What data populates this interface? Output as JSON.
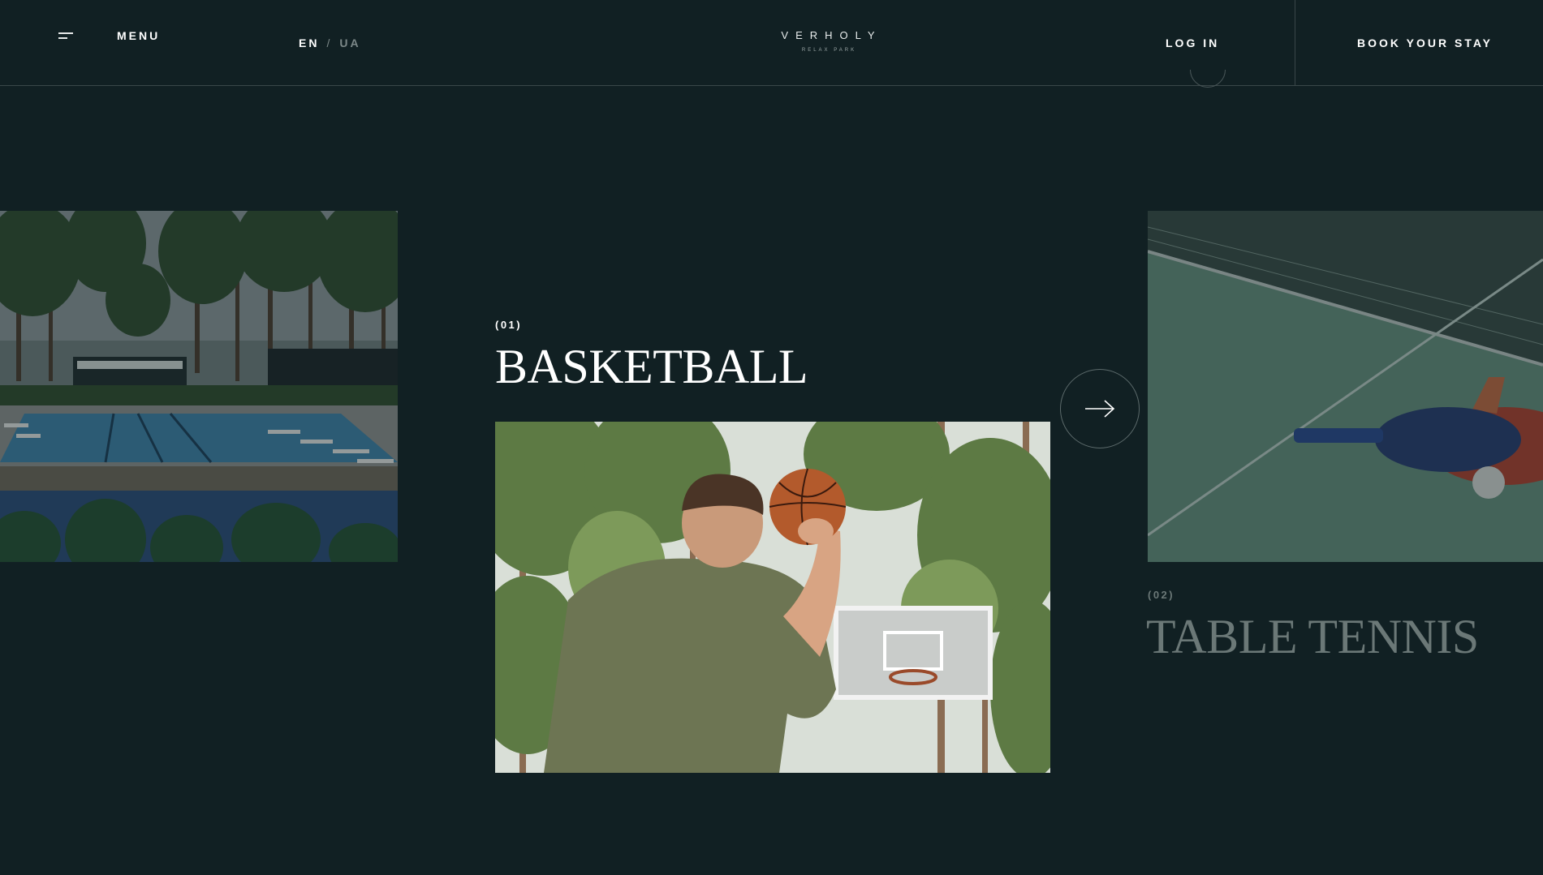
{
  "header": {
    "menu_label": "MENU",
    "lang_active": "EN",
    "lang_separator": "/",
    "lang_inactive": "UA",
    "logo_title": "VERHOLY",
    "logo_subtitle": "RELAX PARK",
    "login_label": "LOG IN",
    "book_label": "BOOK YOUR STAY"
  },
  "slider": {
    "active": {
      "number": "(01)",
      "title": "BASKETBALL"
    },
    "next": {
      "number": "(02)",
      "title": "TABLE TENNIS"
    },
    "next_button_icon": "arrow-right-icon"
  },
  "colors": {
    "background": "#112023",
    "text": "#ffffff",
    "muted_text": "#6b7877",
    "divider": "#3a4749"
  }
}
